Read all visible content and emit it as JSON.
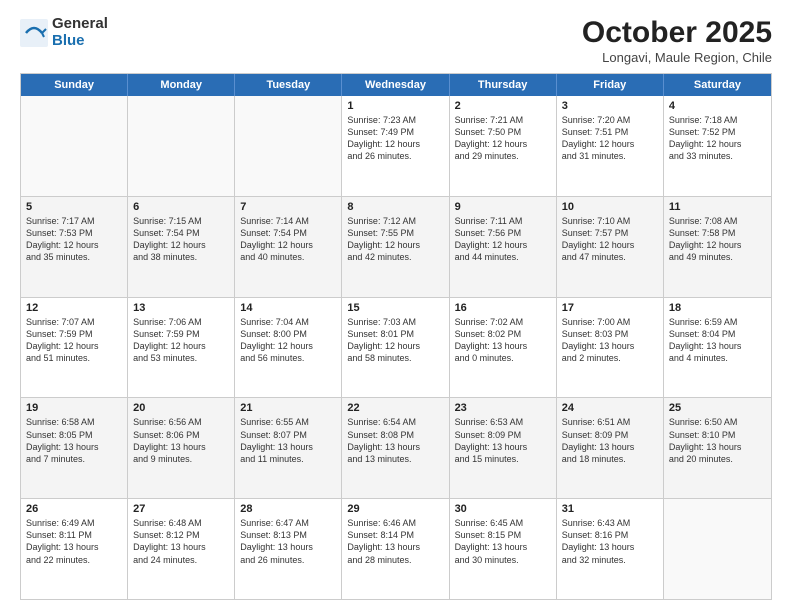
{
  "header": {
    "logo_general": "General",
    "logo_blue": "Blue",
    "month_title": "October 2025",
    "location": "Longavi, Maule Region, Chile"
  },
  "days_of_week": [
    "Sunday",
    "Monday",
    "Tuesday",
    "Wednesday",
    "Thursday",
    "Friday",
    "Saturday"
  ],
  "weeks": [
    [
      {
        "day": "",
        "info": ""
      },
      {
        "day": "",
        "info": ""
      },
      {
        "day": "",
        "info": ""
      },
      {
        "day": "1",
        "info": "Sunrise: 7:23 AM\nSunset: 7:49 PM\nDaylight: 12 hours\nand 26 minutes."
      },
      {
        "day": "2",
        "info": "Sunrise: 7:21 AM\nSunset: 7:50 PM\nDaylight: 12 hours\nand 29 minutes."
      },
      {
        "day": "3",
        "info": "Sunrise: 7:20 AM\nSunset: 7:51 PM\nDaylight: 12 hours\nand 31 minutes."
      },
      {
        "day": "4",
        "info": "Sunrise: 7:18 AM\nSunset: 7:52 PM\nDaylight: 12 hours\nand 33 minutes."
      }
    ],
    [
      {
        "day": "5",
        "info": "Sunrise: 7:17 AM\nSunset: 7:53 PM\nDaylight: 12 hours\nand 35 minutes."
      },
      {
        "day": "6",
        "info": "Sunrise: 7:15 AM\nSunset: 7:54 PM\nDaylight: 12 hours\nand 38 minutes."
      },
      {
        "day": "7",
        "info": "Sunrise: 7:14 AM\nSunset: 7:54 PM\nDaylight: 12 hours\nand 40 minutes."
      },
      {
        "day": "8",
        "info": "Sunrise: 7:12 AM\nSunset: 7:55 PM\nDaylight: 12 hours\nand 42 minutes."
      },
      {
        "day": "9",
        "info": "Sunrise: 7:11 AM\nSunset: 7:56 PM\nDaylight: 12 hours\nand 44 minutes."
      },
      {
        "day": "10",
        "info": "Sunrise: 7:10 AM\nSunset: 7:57 PM\nDaylight: 12 hours\nand 47 minutes."
      },
      {
        "day": "11",
        "info": "Sunrise: 7:08 AM\nSunset: 7:58 PM\nDaylight: 12 hours\nand 49 minutes."
      }
    ],
    [
      {
        "day": "12",
        "info": "Sunrise: 7:07 AM\nSunset: 7:59 PM\nDaylight: 12 hours\nand 51 minutes."
      },
      {
        "day": "13",
        "info": "Sunrise: 7:06 AM\nSunset: 7:59 PM\nDaylight: 12 hours\nand 53 minutes."
      },
      {
        "day": "14",
        "info": "Sunrise: 7:04 AM\nSunset: 8:00 PM\nDaylight: 12 hours\nand 56 minutes."
      },
      {
        "day": "15",
        "info": "Sunrise: 7:03 AM\nSunset: 8:01 PM\nDaylight: 12 hours\nand 58 minutes."
      },
      {
        "day": "16",
        "info": "Sunrise: 7:02 AM\nSunset: 8:02 PM\nDaylight: 13 hours\nand 0 minutes."
      },
      {
        "day": "17",
        "info": "Sunrise: 7:00 AM\nSunset: 8:03 PM\nDaylight: 13 hours\nand 2 minutes."
      },
      {
        "day": "18",
        "info": "Sunrise: 6:59 AM\nSunset: 8:04 PM\nDaylight: 13 hours\nand 4 minutes."
      }
    ],
    [
      {
        "day": "19",
        "info": "Sunrise: 6:58 AM\nSunset: 8:05 PM\nDaylight: 13 hours\nand 7 minutes."
      },
      {
        "day": "20",
        "info": "Sunrise: 6:56 AM\nSunset: 8:06 PM\nDaylight: 13 hours\nand 9 minutes."
      },
      {
        "day": "21",
        "info": "Sunrise: 6:55 AM\nSunset: 8:07 PM\nDaylight: 13 hours\nand 11 minutes."
      },
      {
        "day": "22",
        "info": "Sunrise: 6:54 AM\nSunset: 8:08 PM\nDaylight: 13 hours\nand 13 minutes."
      },
      {
        "day": "23",
        "info": "Sunrise: 6:53 AM\nSunset: 8:09 PM\nDaylight: 13 hours\nand 15 minutes."
      },
      {
        "day": "24",
        "info": "Sunrise: 6:51 AM\nSunset: 8:09 PM\nDaylight: 13 hours\nand 18 minutes."
      },
      {
        "day": "25",
        "info": "Sunrise: 6:50 AM\nSunset: 8:10 PM\nDaylight: 13 hours\nand 20 minutes."
      }
    ],
    [
      {
        "day": "26",
        "info": "Sunrise: 6:49 AM\nSunset: 8:11 PM\nDaylight: 13 hours\nand 22 minutes."
      },
      {
        "day": "27",
        "info": "Sunrise: 6:48 AM\nSunset: 8:12 PM\nDaylight: 13 hours\nand 24 minutes."
      },
      {
        "day": "28",
        "info": "Sunrise: 6:47 AM\nSunset: 8:13 PM\nDaylight: 13 hours\nand 26 minutes."
      },
      {
        "day": "29",
        "info": "Sunrise: 6:46 AM\nSunset: 8:14 PM\nDaylight: 13 hours\nand 28 minutes."
      },
      {
        "day": "30",
        "info": "Sunrise: 6:45 AM\nSunset: 8:15 PM\nDaylight: 13 hours\nand 30 minutes."
      },
      {
        "day": "31",
        "info": "Sunrise: 6:43 AM\nSunset: 8:16 PM\nDaylight: 13 hours\nand 32 minutes."
      },
      {
        "day": "",
        "info": ""
      }
    ]
  ]
}
